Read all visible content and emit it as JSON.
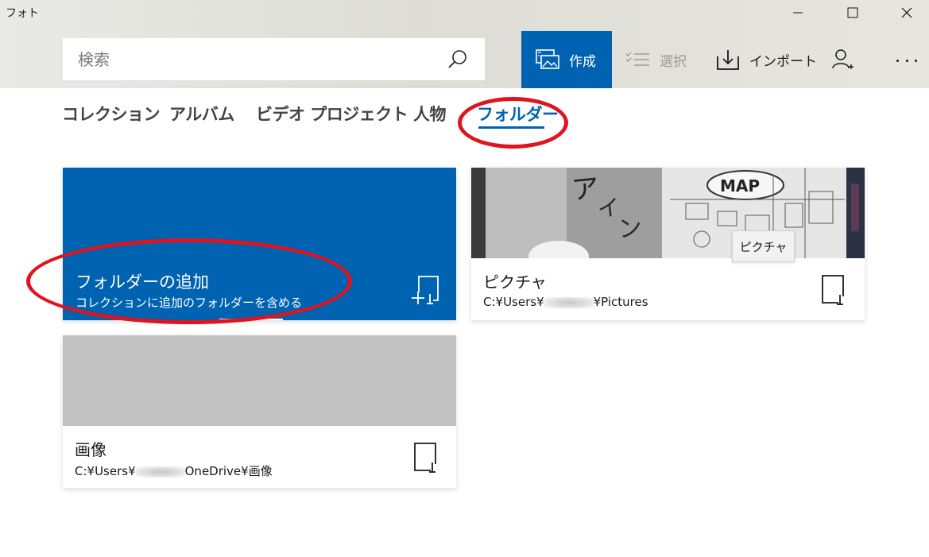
{
  "window": {
    "title": "フォト"
  },
  "search": {
    "placeholder": "検索"
  },
  "toolbar": {
    "create_label": "作成",
    "select_label": "選択",
    "import_label": "インポート",
    "accent_color": "#0063b1"
  },
  "tabs": [
    {
      "label": "コレクション",
      "active": false
    },
    {
      "label": "アルバム",
      "active": false
    },
    {
      "label": "ビデオ プロジェクト",
      "active": false
    },
    {
      "label": "人物",
      "active": false
    },
    {
      "label": "フォルダー",
      "active": true
    }
  ],
  "add_folder": {
    "title": "フォルダーの追加",
    "subtitle": "コレクションに追加のフォルダーを含める"
  },
  "folders": [
    {
      "name": "ピクチャ",
      "path_prefix": "C:¥Users¥",
      "path_suffix": "¥Pictures",
      "tooltip": "ピクチャ"
    },
    {
      "name": "画像",
      "path_prefix": "C:¥Users¥",
      "path_suffix": "OneDrive¥画像"
    }
  ],
  "thumbnail_text": {
    "map_label": "MAP"
  },
  "annotations": {
    "highlight_color": "#e0141e"
  }
}
